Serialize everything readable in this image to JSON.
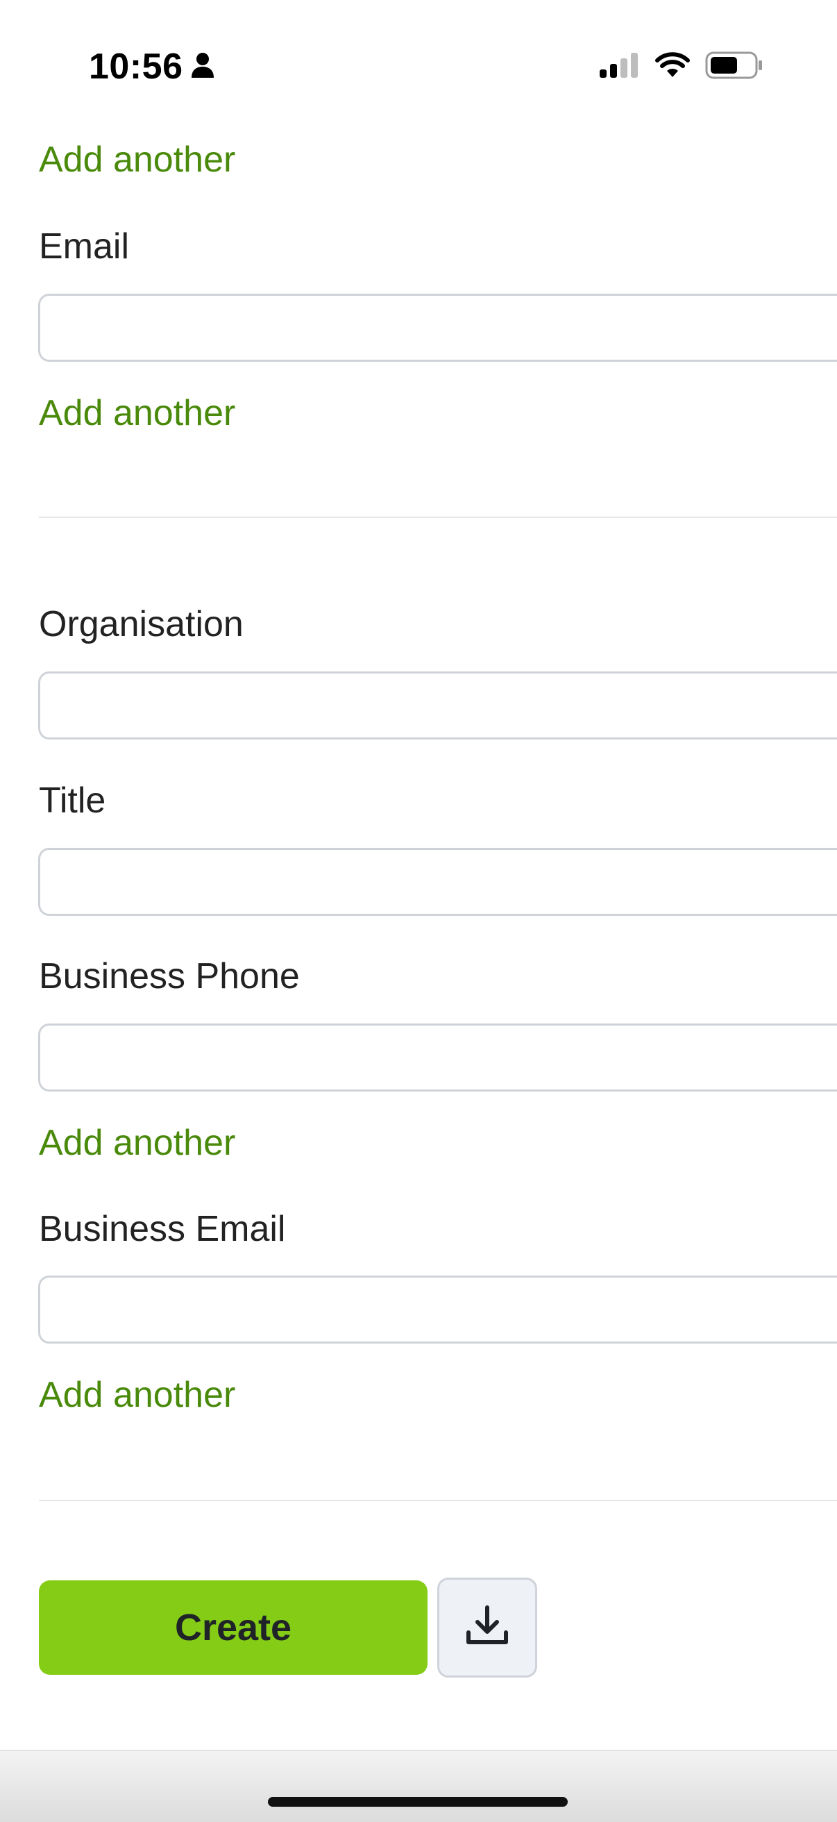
{
  "status_bar": {
    "time": "10:56",
    "icons": [
      "person-icon",
      "signal-icon",
      "wifi-icon",
      "battery-icon"
    ]
  },
  "form": {
    "add_another_label": "Add another",
    "email_label": "Email",
    "organisation_label": "Organisation",
    "title_label": "Title",
    "business_phone_label": "Business Phone",
    "business_email_label": "Business Email",
    "email_value": "",
    "organisation_value": "",
    "title_value": "",
    "business_phone_value": "",
    "business_email_value": ""
  },
  "actions": {
    "create_label": "Create",
    "download_icon": "download-icon"
  },
  "colors": {
    "link": "#4a8a0b",
    "primary": "#84cc16",
    "secondary_bg": "#eef1f6"
  }
}
